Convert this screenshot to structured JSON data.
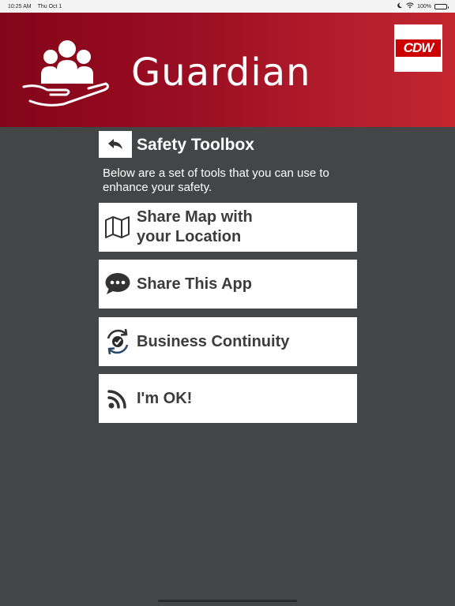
{
  "status_bar": {
    "time": "10:25 AM",
    "date": "Thu Oct 1",
    "battery": "100%"
  },
  "banner": {
    "title": "Guardian",
    "brand": "CDW",
    "colors": {
      "gradient_start": "#840519",
      "gradient_end": "#c3262f"
    }
  },
  "header": {
    "title": "Safety Toolbox"
  },
  "description": "Below are a set of tools that you can use to enhance your safety.",
  "tools": [
    {
      "label": "Share Map with your Location",
      "icon": "map-icon"
    },
    {
      "label": "Share This App",
      "icon": "chat-bubble-icon"
    },
    {
      "label": "Business Continuity",
      "icon": "sync-check-icon"
    },
    {
      "label": "I'm OK!",
      "icon": "rss-icon"
    }
  ],
  "colors": {
    "background": "#444546",
    "card": "#ffffff",
    "text_dark": "#3c3c3c"
  }
}
